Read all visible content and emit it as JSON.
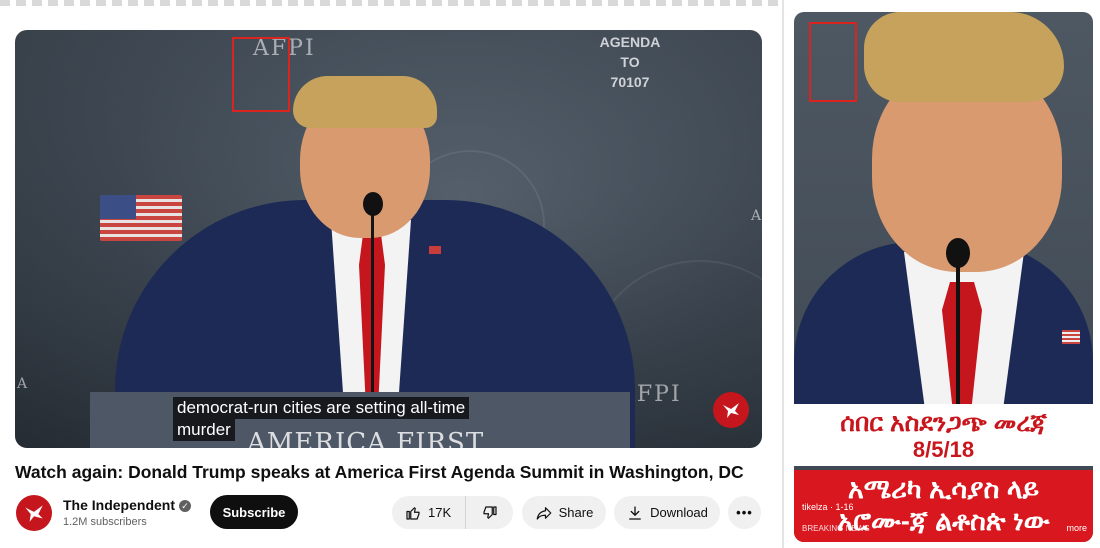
{
  "main_video": {
    "wall_text_left": "AFPI",
    "wall_text_agenda": [
      "AGENDA",
      "TO",
      "70107"
    ],
    "wall_text_right": "AFPI",
    "wall_text_small_left": "A",
    "wall_text_small_right": "A",
    "podium_text": "AMERICA FIRST",
    "caption_line1": "democrat-run cities are setting all-time",
    "caption_line2": "murder"
  },
  "video_title": "Watch again: Donald Trump speaks at America First Agenda Summit in Washington, DC",
  "channel": {
    "name": "The Independent",
    "subscribers": "1.2M subscribers",
    "subscribe_label": "Subscribe"
  },
  "actions": {
    "like_count": "17K",
    "share_label": "Share",
    "download_label": "Download",
    "more_label": "•••"
  },
  "short": {
    "headline_line1": "ሰበር አስደንጋጭ መረጃ",
    "headline_line2": "8/5/18",
    "headline_line3": "አሜሪካ ኢሳያስ ላይ",
    "headline_line4": "አሮሙ-ጃ ልቶስጵ ነው",
    "channel_meta": "tikelza · 1-16",
    "breaking": "BREAKING NEWS",
    "more_label": "more"
  },
  "colors": {
    "accent_red": "#c8161d",
    "brand_red": "#c4161c",
    "box_red": "#d9241f"
  }
}
